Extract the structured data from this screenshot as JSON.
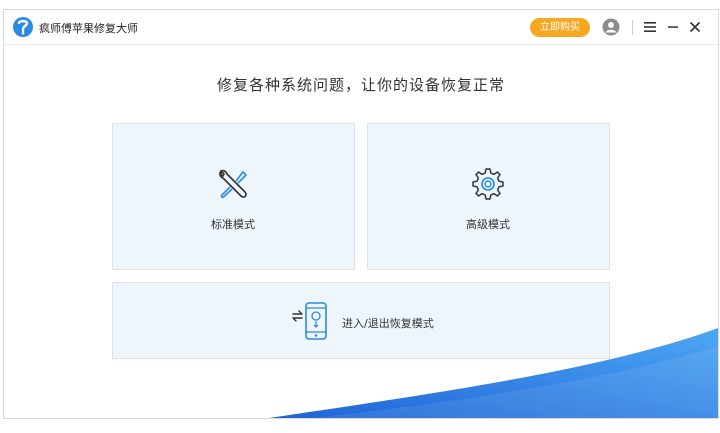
{
  "app": {
    "title": "疯师傅苹果修复大师",
    "buy_label": "立即购买"
  },
  "icons": {
    "logo": "app-logo-icon",
    "avatar": "user-avatar-icon",
    "menu": "hamburger-menu-icon",
    "minimize": "minimize-icon",
    "close": "close-icon",
    "standard": "wrench-screwdriver-icon",
    "advanced": "gear-icon",
    "recovery": "phone-transfer-icon"
  },
  "main": {
    "headline": "修复各种系统问题，让你的设备恢复正常",
    "cards": {
      "standard": {
        "label": "标准模式"
      },
      "advanced": {
        "label": "高级模式"
      },
      "recovery": {
        "label": "进入/退出恢复模式"
      }
    }
  },
  "colors": {
    "accent_blue": "#2b7fe0",
    "buy_orange": "#f6a821",
    "card_bg": "#eef5fb"
  }
}
